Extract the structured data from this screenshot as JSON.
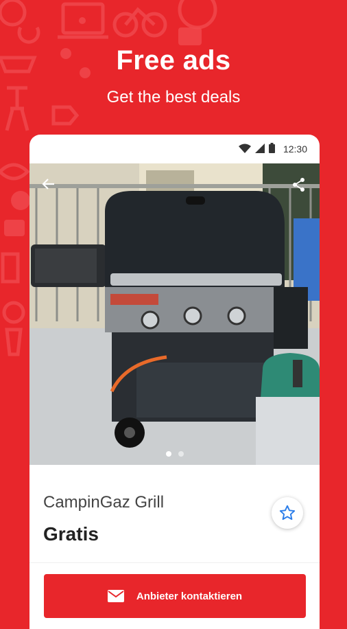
{
  "hero": {
    "headline": "Free ads",
    "subheadline": "Get the best deals"
  },
  "statusbar": {
    "time": "12:30",
    "icons": [
      "wifi-icon",
      "signal-icon",
      "battery-icon"
    ]
  },
  "listing": {
    "title": "CampinGaz Grill",
    "price": "Gratis",
    "carousel": {
      "total_images": 2,
      "active_index": 0
    },
    "contact_button_label": "Anbieter kontaktieren"
  },
  "colors": {
    "brand_red": "#e8262b",
    "card_white": "#ffffff",
    "favorite_star": "#2b7de9"
  }
}
